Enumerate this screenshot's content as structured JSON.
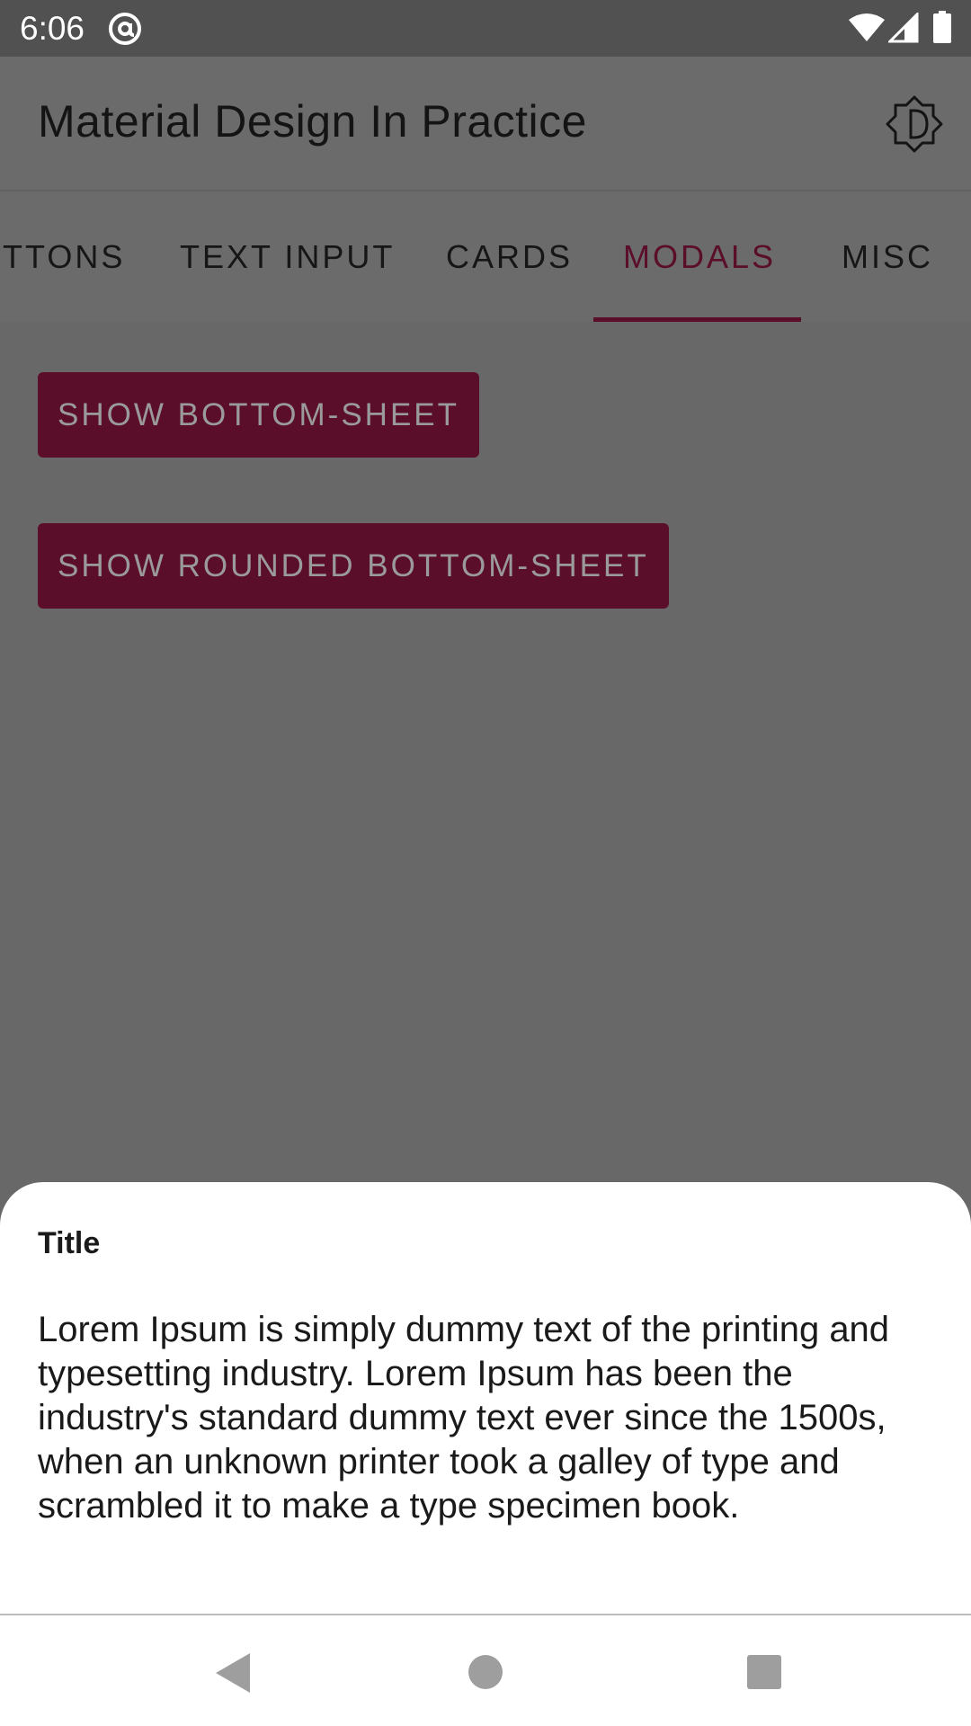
{
  "status_bar": {
    "time": "6:06",
    "icons": [
      "at-sign-icon",
      "wifi-icon",
      "cell-signal-icon",
      "battery-icon"
    ]
  },
  "app_bar": {
    "title": "Material Design In Practice",
    "action_icon": "brightness-auto-icon"
  },
  "tabs": {
    "items": [
      {
        "label": "TTONS"
      },
      {
        "label": "TEXT INPUT"
      },
      {
        "label": "CARDS"
      },
      {
        "label": "MODALS"
      },
      {
        "label": "MISC"
      }
    ],
    "selected": "MODALS"
  },
  "content": {
    "show_bottom_sheet_label": "SHOW BOTTOM-SHEET",
    "show_rounded_bottom_sheet_label": "SHOW ROUNDED BOTTOM-SHEET"
  },
  "bottom_sheet": {
    "title": "Title",
    "body": "Lorem Ipsum is simply dummy text of the printing and typesetting industry. Lorem Ipsum has been the industry's standard dummy text ever since the 1500s, when an unknown printer took a galley of type and scrambled it to make a type specimen book."
  },
  "nav_bar": {
    "icons": [
      "back-icon",
      "home-icon",
      "recents-icon"
    ]
  },
  "colors": {
    "accent": "#5b0e2a",
    "scrim": "#686868",
    "status_bar": "#515151",
    "sheet_background": "#ffffff"
  }
}
